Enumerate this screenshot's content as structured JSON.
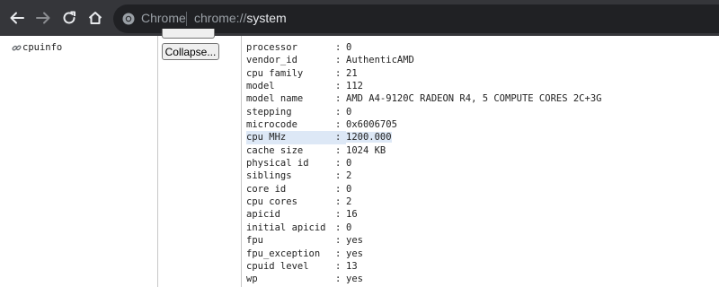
{
  "browser": {
    "chip_label": "Chrome",
    "url_scheme": "chrome://",
    "url_host": "system"
  },
  "sidebar": {
    "link_label": "cpuinfo"
  },
  "buttons": {
    "collapse_label": "Collapse..."
  },
  "info": {
    "separator": ":",
    "rows": [
      {
        "key": "processor",
        "value": "0"
      },
      {
        "key": "vendor_id",
        "value": "AuthenticAMD"
      },
      {
        "key": "cpu family",
        "value": "21"
      },
      {
        "key": "model",
        "value": "112"
      },
      {
        "key": "model name",
        "value": "AMD A4-9120C RADEON R4, 5 COMPUTE CORES 2C+3G"
      },
      {
        "key": "stepping",
        "value": "0"
      },
      {
        "key": "microcode",
        "value": "0x6006705"
      },
      {
        "key": "cpu MHz",
        "value": "1200.000",
        "highlighted": true
      },
      {
        "key": "cache size",
        "value": "1024 KB"
      },
      {
        "key": "physical id",
        "value": "0"
      },
      {
        "key": "siblings",
        "value": "2"
      },
      {
        "key": "core id",
        "value": "0"
      },
      {
        "key": "cpu cores",
        "value": "2"
      },
      {
        "key": "apicid",
        "value": "16"
      },
      {
        "key": "initial apicid",
        "value": "0"
      },
      {
        "key": "fpu",
        "value": "yes"
      },
      {
        "key": "fpu_exception",
        "value": "yes"
      },
      {
        "key": "cpuid level",
        "value": "13"
      },
      {
        "key": "wp",
        "value": "yes"
      }
    ]
  },
  "colors": {
    "toolbar": "#35363a",
    "omnibox": "#202124",
    "highlight": "#dde8f6"
  }
}
